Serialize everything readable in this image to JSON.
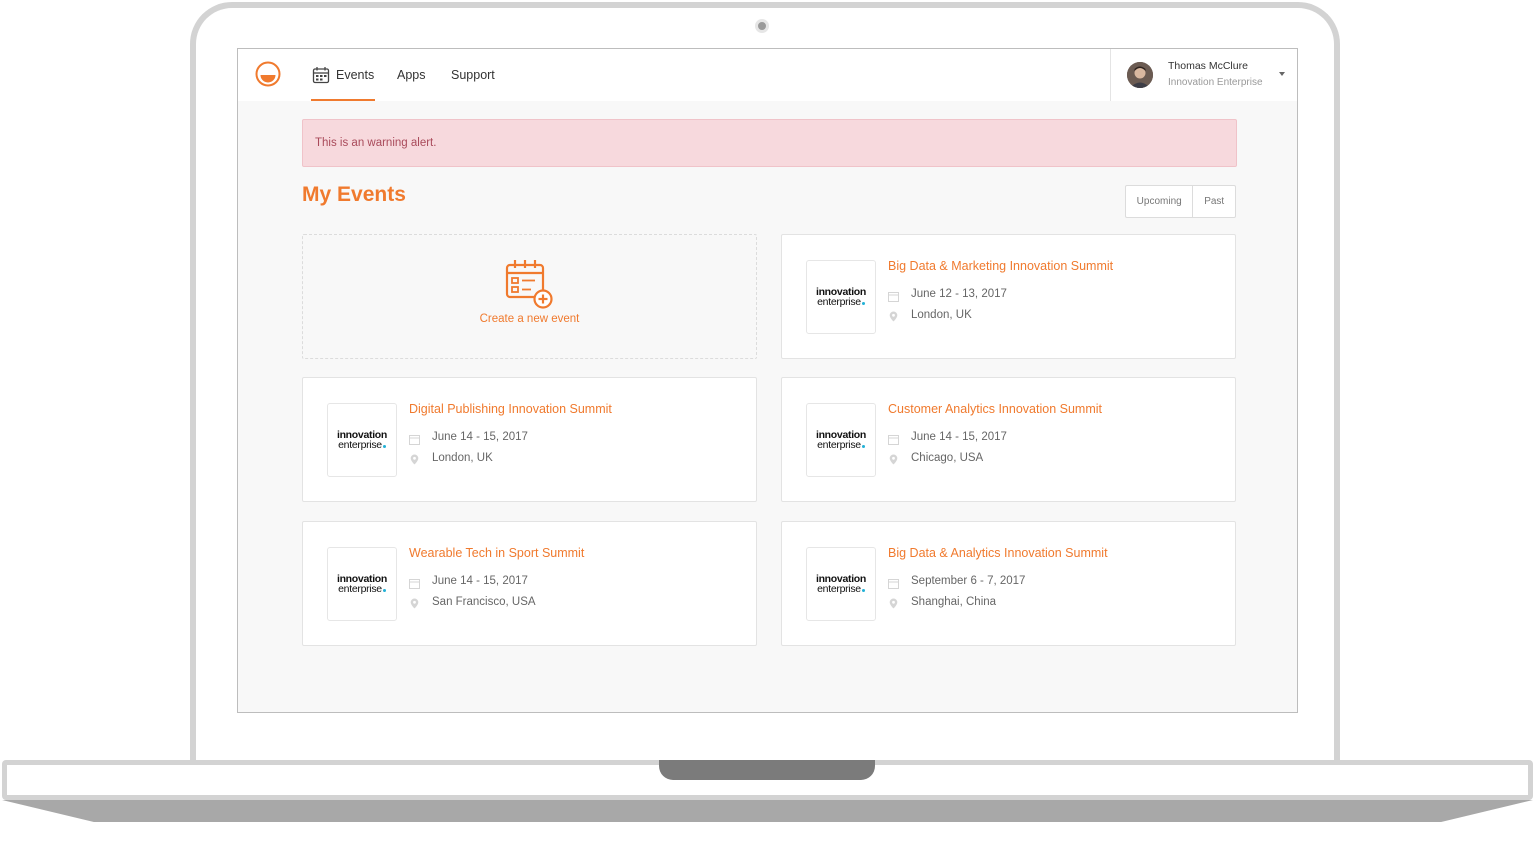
{
  "nav": {
    "items": [
      {
        "label": "Events",
        "active": true
      },
      {
        "label": "Apps"
      },
      {
        "label": "Support"
      }
    ]
  },
  "user": {
    "name": "Thomas McClure",
    "org": "Innovation Enterprise"
  },
  "alert": {
    "text": "This is an warning alert."
  },
  "page": {
    "title": "My Events",
    "filters": [
      "Upcoming",
      "Past"
    ]
  },
  "create_card": {
    "label": "Create a new event"
  },
  "logo_text": {
    "line1": "innovation",
    "line2": "enterprise"
  },
  "events": [
    {
      "title": "Big Data & Marketing Innovation Summit",
      "date": "June 12 - 13, 2017",
      "location": "London, UK"
    },
    {
      "title": "Digital Publishing Innovation Summit",
      "date": "June 14 - 15, 2017",
      "location": "London, UK"
    },
    {
      "title": "Customer Analytics Innovation Summit",
      "date": "June 14 - 15, 2017",
      "location": "Chicago, USA"
    },
    {
      "title": "Wearable Tech in Sport Summit",
      "date": "June 14 - 15, 2017",
      "location": "San Francisco, USA"
    },
    {
      "title": "Big Data & Analytics Innovation Summit",
      "date": "September 6 - 7, 2017",
      "location": "Shanghai, China"
    }
  ],
  "colors": {
    "accent": "#f07a2e",
    "alert_bg": "#f7d9dd",
    "alert_text": "#a94a5a",
    "screen_bg": "#f8f8f8"
  },
  "icons": [
    "brand-logo-icon",
    "calendar-icon",
    "calendar-add-icon",
    "location-pin-icon",
    "chevron-down-icon",
    "user-avatar"
  ]
}
